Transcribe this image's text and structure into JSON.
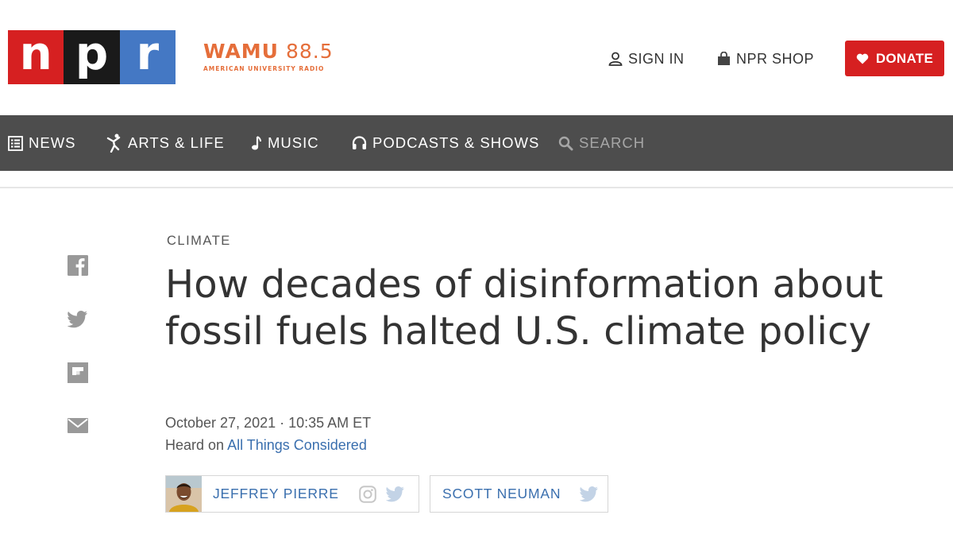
{
  "header": {
    "logo": {
      "letters": [
        "n",
        "p",
        "r"
      ],
      "colors": [
        "#d62021",
        "#1a1a1a",
        "#4478c4"
      ]
    },
    "station": {
      "call": "WAMU",
      "freq": "88.5",
      "tagline": "AMERICAN UNIVERSITY RADIO",
      "color": "#e56e3a"
    },
    "sign_in": "SIGN IN",
    "shop": "NPR SHOP",
    "donate": "DONATE"
  },
  "nav": {
    "items": [
      {
        "label": "NEWS",
        "icon": "news-list-icon"
      },
      {
        "label": "ARTS & LIFE",
        "icon": "dancer-icon"
      },
      {
        "label": "MUSIC",
        "icon": "music-note-icon"
      },
      {
        "label": "PODCASTS & SHOWS",
        "icon": "headphones-icon"
      }
    ],
    "search": "SEARCH"
  },
  "share": [
    "facebook-icon",
    "twitter-icon",
    "flipboard-icon",
    "email-icon"
  ],
  "article": {
    "slug": "CLIMATE",
    "headline": "How decades of disinformation about fossil fuels halted U.S. climate policy",
    "date": "October 27, 2021 · 10:35 AM ET",
    "heard_on_prefix": "Heard on ",
    "program": "All Things Considered",
    "bylines": [
      {
        "name": "JEFFREY PIERRE"
      },
      {
        "name": "SCOTT NEUMAN"
      }
    ]
  },
  "colors": {
    "nav_bg": "#4d4d4d",
    "donate": "#d62021",
    "link": "#3a6fae",
    "icon_gray": "#999999"
  }
}
